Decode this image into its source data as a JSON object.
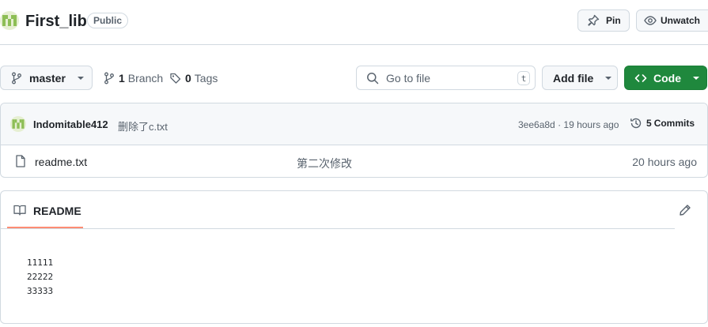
{
  "repo": {
    "name": "First_lib",
    "visibility": "Public"
  },
  "header_actions": {
    "pin_label": "Pin",
    "unwatch_label": "Unwatch"
  },
  "toolbar": {
    "branch_name": "master",
    "branches_count": "1",
    "branches_label": "Branch",
    "tags_count": "0",
    "tags_label": "Tags",
    "search_placeholder": "Go to file",
    "search_shortcut": "t",
    "add_file_label": "Add file",
    "code_label": "Code"
  },
  "commit": {
    "author": "Indomitable412",
    "message": "删除了c.txt",
    "hash": "3ee6a8d",
    "separator": "·",
    "time": "19 hours ago",
    "commits_count": "5",
    "commits_label": "Commits"
  },
  "files": [
    {
      "name": "readme.txt",
      "message": "第二次修改",
      "time": "20 hours ago"
    }
  ],
  "readme": {
    "tab_label": "README",
    "lines": [
      "11111",
      "22222",
      "33333"
    ]
  },
  "colors": {
    "accent_green": "#1f883d",
    "tab_underline": "#fd8c73",
    "border": "#d1d9e0"
  }
}
